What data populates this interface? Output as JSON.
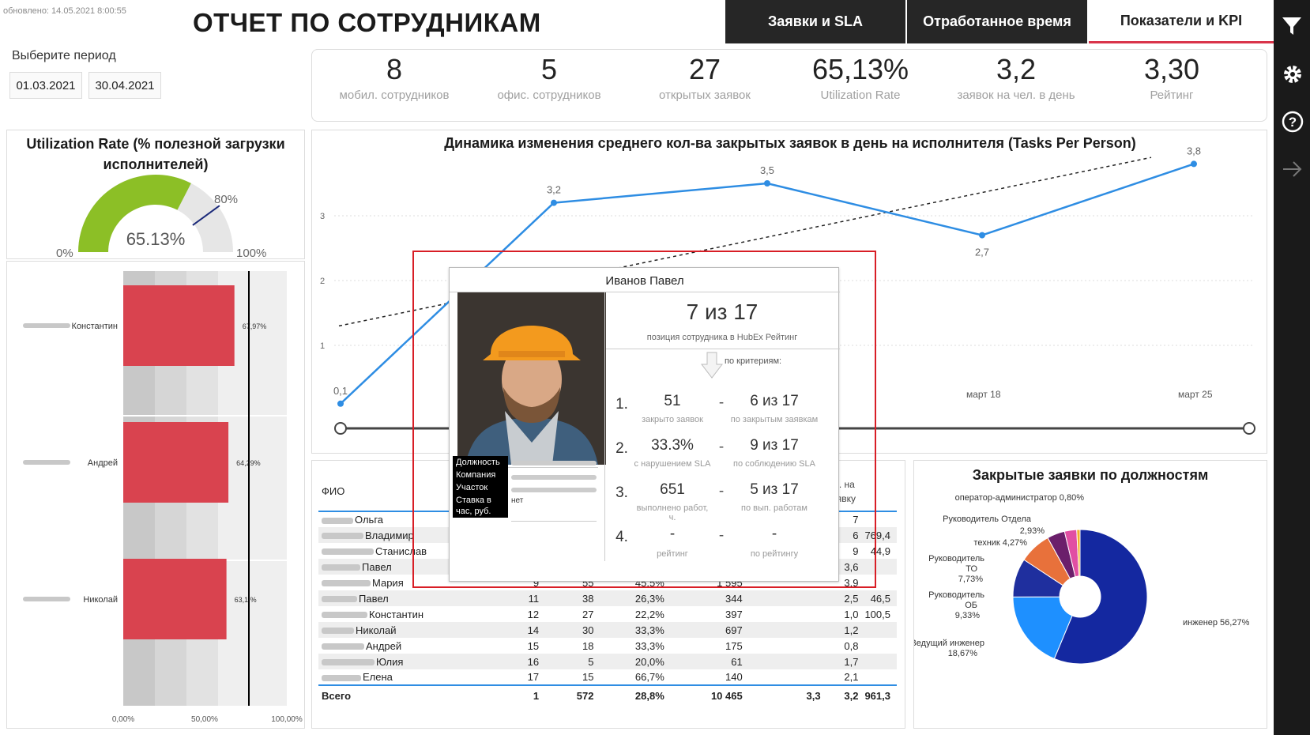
{
  "header": {
    "updated": "обновлено: 14.05.2021 8:00:55",
    "title": "ОТЧЕТ ПО СОТРУДНИКАМ",
    "tabs": [
      {
        "label": "Заявки и SLA"
      },
      {
        "label": "Отработанное время"
      },
      {
        "label": "Показатели и KPI"
      }
    ]
  },
  "filters": {
    "period_label": "Выберите период",
    "date_from": "01.03.2021",
    "date_to": "30.04.2021"
  },
  "kpis": [
    {
      "value": "8",
      "label": "мобил. сотрудников"
    },
    {
      "value": "5",
      "label": "офис. сотрудников"
    },
    {
      "value": "27",
      "label": "открытых заявок"
    },
    {
      "value": "65,13%",
      "label": "Utilization Rate"
    },
    {
      "value": "3,2",
      "label": "заявок на чел. в день"
    },
    {
      "value": "3,30",
      "label": "Рейтинг"
    }
  ],
  "gauge": {
    "title_line1": "Utilization Rate (% полезной загрузки",
    "title_line2": "исполнителей)",
    "value_label": "65.13%",
    "value": 65.13,
    "target_label": "80%",
    "min_label": "0%",
    "max_label": "100%",
    "color": "#8cbf26"
  },
  "util_bars": {
    "items": [
      {
        "name": "Константин",
        "value_label": "67,97%",
        "value": 67.97
      },
      {
        "name": "Андрей",
        "value_label": "64,29%",
        "value": 64.29
      },
      {
        "name": "Николай",
        "value_label": "63,1 %",
        "value": 63.1
      }
    ],
    "axis_ticks": [
      "0,00%",
      "50,00%",
      "100,00%"
    ],
    "bar_color": "#d9434f"
  },
  "chart_data": {
    "type": "line",
    "title": "Динамика изменения среднего кол-ва закрытых заявок в день на исполнителя (Tasks Per Person)",
    "x": [
      "",
      "",
      "",
      "март 18",
      "март 25"
    ],
    "series": [
      {
        "values": [
          0.1,
          3.2,
          3.5,
          2.7,
          3.8
        ]
      }
    ],
    "point_labels": [
      "0,1",
      "3,2",
      "3,5",
      "2,7",
      "3,8"
    ],
    "y_ticks": [
      "1",
      "2",
      "3"
    ],
    "ylim": [
      0,
      4
    ],
    "trend": [
      1.3,
      3.9
    ],
    "color": "#2e8de3"
  },
  "table": {
    "headers": [
      "ФИО",
      "",
      "",
      "",
      "",
      "",
      "Км. на заявку"
    ],
    "rows": [
      {
        "name": "Ольга",
        "cells": [
          "",
          "",
          "",
          "",
          "",
          "7",
          ""
        ]
      },
      {
        "name": "Владимир",
        "cells": [
          "",
          "",
          "",
          "",
          "",
          "6",
          "769,4"
        ]
      },
      {
        "name": "Станислав",
        "cells": [
          "",
          "",
          "",
          "",
          "",
          "9",
          "44,9"
        ]
      },
      {
        "name": "Павел",
        "cells": [
          "",
          "",
          "",
          "",
          "",
          "3,6",
          ""
        ]
      },
      {
        "name": "Мария",
        "cells": [
          "9",
          "55",
          "45,5%",
          "1 595",
          "",
          "3,9",
          ""
        ]
      },
      {
        "name": "Павел",
        "cells": [
          "11",
          "38",
          "26,3%",
          "344",
          "",
          "2,5",
          "46,5"
        ]
      },
      {
        "name": "Константин",
        "cells": [
          "12",
          "27",
          "22,2%",
          "397",
          "",
          "1,0",
          "100,5"
        ]
      },
      {
        "name": "Николай",
        "cells": [
          "14",
          "30",
          "33,3%",
          "697",
          "",
          "1,2",
          ""
        ]
      },
      {
        "name": "Андрей",
        "cells": [
          "15",
          "18",
          "33,3%",
          "175",
          "",
          "0,8",
          ""
        ]
      },
      {
        "name": "Юлия",
        "cells": [
          "16",
          "5",
          "20,0%",
          "61",
          "",
          "1,7",
          ""
        ]
      },
      {
        "name": "Елена",
        "cells": [
          "17",
          "15",
          "66,7%",
          "140",
          "",
          "2,1",
          ""
        ]
      }
    ],
    "total": {
      "name": "Всего",
      "cells": [
        "1",
        "572",
        "28,8%",
        "10 465",
        "3,3",
        "3,2",
        "961,3"
      ]
    }
  },
  "donut": {
    "title": "Закрытые заявки по должностям",
    "slices": [
      {
        "label": "инженер 56,27%",
        "value": 56.27,
        "color": "#1428a0"
      },
      {
        "label": "Ведущий инженер 18,67%",
        "value": 18.67,
        "color": "#1e90ff"
      },
      {
        "label": "Руководитель ОБ 9,33%",
        "value": 9.33,
        "color": "#1f2f9e"
      },
      {
        "label": "Руководитель ТО 7,73%",
        "value": 7.73,
        "color": "#e8713b"
      },
      {
        "label": "техник 4,27%",
        "value": 4.27,
        "color": "#6b1f6b"
      },
      {
        "label": "Руководитель Отдела 2,93%",
        "value": 2.93,
        "color": "#e14fa3"
      },
      {
        "label": "оператор-администратор 0,80%",
        "value": 0.8,
        "color": "#f2b12a"
      }
    ]
  },
  "tooltip": {
    "name": "Иванов Павел",
    "position": "7 из 17",
    "position_caption": "позиция сотрудника в HubEx Рейтинг",
    "criteria_caption": "по критериям:",
    "fields": [
      {
        "label": "Должность",
        "value": ""
      },
      {
        "label": "Компания",
        "value": ""
      },
      {
        "label": "Участок",
        "value": ""
      },
      {
        "label": "Ставка в час, руб.",
        "value": "нет"
      }
    ],
    "criteria": [
      {
        "num": "1.",
        "value": "51",
        "caption": "закрыто заявок",
        "rank": "6 из 17",
        "rank_caption": "по закрытым заявкам"
      },
      {
        "num": "2.",
        "value": "33.3%",
        "caption": "с нарушением SLA",
        "rank": "9 из 17",
        "rank_caption": "по соблюдению SLA"
      },
      {
        "num": "3.",
        "value": "651",
        "caption": "выполнено работ, ч.",
        "rank": "5 из 17",
        "rank_caption": "по вып. работам"
      },
      {
        "num": "4.",
        "value": "-",
        "caption": "рейтинг",
        "rank": "-",
        "rank_caption": "по рейтингу"
      }
    ]
  }
}
